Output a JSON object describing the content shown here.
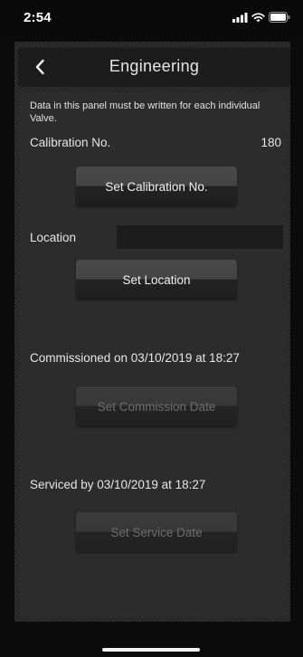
{
  "status_bar": {
    "time": "2:54"
  },
  "nav": {
    "title": "Engineering",
    "back_icon": "chevron-left-icon"
  },
  "panel": {
    "note": "Data in this panel must be written for each individual Valve.",
    "calibration": {
      "label": "Calibration No.",
      "value": "180",
      "button_label": "Set Calibration No."
    },
    "location": {
      "label": "Location",
      "value": "",
      "button_label": "Set Location"
    },
    "commission": {
      "text": "Commissioned on 03/10/2019 at 18:27",
      "button_label": "Set Commission Date"
    },
    "service": {
      "text": "Serviced by 03/10/2019 at 18:27",
      "button_label": "Set Service Date"
    }
  },
  "colors": {
    "background": "#0b0b0b",
    "panel": "#2c2c2c",
    "nav_bar": "#1c1c1c",
    "text": "#e6e6e6",
    "disabled_text": "#6e6e6e"
  }
}
